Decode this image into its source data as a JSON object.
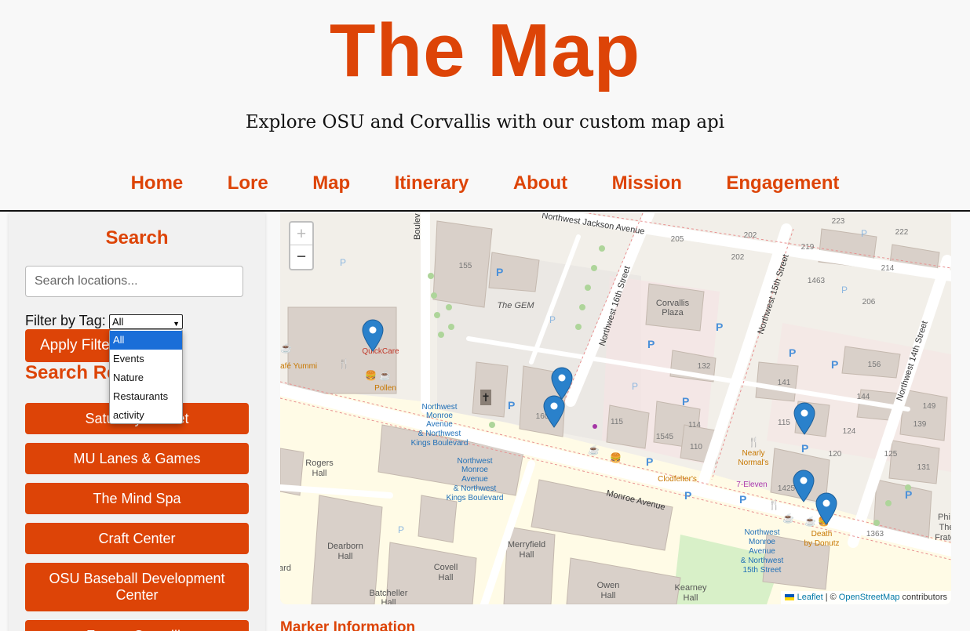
{
  "header": {
    "title": "The Map",
    "subtitle": "Explore OSU and Corvallis with our custom map api"
  },
  "nav": [
    "Home",
    "Lore",
    "Map",
    "Itinerary",
    "About",
    "Mission",
    "Engagement"
  ],
  "sidebar": {
    "search_heading": "Search",
    "search_placeholder": "Search locations...",
    "filter_label": "Filter by Tag:",
    "filter_value": "All",
    "filter_options": [
      "All",
      "Events",
      "Nature",
      "Restaurants",
      "activity"
    ],
    "apply_label": "Apply Filter",
    "results_heading": "Search Results",
    "results": [
      "Saturday Market",
      "MU Lanes & Games",
      "The Mind Spa",
      "Craft Center",
      "OSU Baseball Development Center",
      "Fresco Corvallis"
    ]
  },
  "map": {
    "zoom_in": "+",
    "zoom_out": "−",
    "attribution": {
      "leaflet": "Leaflet",
      "sep": "| ©",
      "osm": "OpenStreetMap",
      "contributors": "contributors"
    },
    "labels": {
      "jackson": "Northwest Jackson Avenue",
      "monroe": "Monroe Avenue",
      "st16": "Northwest 16th Street",
      "st15": "Northwest 15th Street",
      "st14": "Northwest 14th Street",
      "boulevard": "Boulevard",
      "gem": "The GEM",
      "corvallis_plaza_1": "Corvallis",
      "corvallis_plaza_2": "Plaza",
      "quickcare": "QuickCare",
      "pollen": "Pollen",
      "cafe_yummi": "Café Yummi",
      "rogers_1": "Rogers",
      "rogers_2": "Hall",
      "dearborn_1": "Dearborn",
      "dearborn_2": "Hall",
      "covell_1": "Covell",
      "covell_2": "Hall",
      "merryfield_1": "Merryfield",
      "merryfield_2": "Hall",
      "batcheller_1": "Batcheller",
      "batcheller_2": "Hall",
      "owen_1": "Owen",
      "owen_2": "Hall",
      "kearney_1": "Kearney",
      "kearney_2": "Hall",
      "nearly_1": "Nearly",
      "nearly_2": "Normal's",
      "seven_eleven": "7-Eleven",
      "clodfelter": "Clodfelter's",
      "death_1": "Death",
      "death_2": "by Donutz",
      "stop1_1": "Northwest",
      "stop1_2": "Monroe",
      "stop1_3": "Avenue",
      "stop1_4": "& Northwest",
      "stop1_5": "Kings Boulevard",
      "stop2_1": "Northwest",
      "stop2_2": "Monroe",
      "stop2_3": "Avenue",
      "stop2_4": "& Northwest",
      "stop2_5": "Kings Boulevard",
      "stop3_1": "Northwest",
      "stop3_2": "Monroe",
      "stop3_3": "Avenue",
      "stop3_4": "& Northwest",
      "stop3_5": "15th Street",
      "phi": "Phi",
      "the": "The",
      "frat": "Frate",
      "ard": "ard",
      "n155": "155",
      "n205": "205",
      "n202a": "202",
      "n202b": "202",
      "n219": "219",
      "n223": "223",
      "n222": "222",
      "n1463": "1463",
      "n214": "214",
      "n206": "206",
      "n132": "132",
      "n141": "141",
      "n156": "156",
      "n144": "144",
      "n149": "149",
      "n139": "139",
      "n115a": "115",
      "n115b": "115",
      "n124": "124",
      "n120": "120",
      "n125": "125",
      "n131": "131",
      "n1545": "1545",
      "n114": "114",
      "n110": "110",
      "n1425": "1425",
      "n1363": "1363",
      "n160": "160"
    }
  },
  "marker_info": "Marker Information",
  "colors": {
    "accent": "#dd4407",
    "marker": "#2a81cb",
    "selected_option": "#1a6ed8"
  }
}
